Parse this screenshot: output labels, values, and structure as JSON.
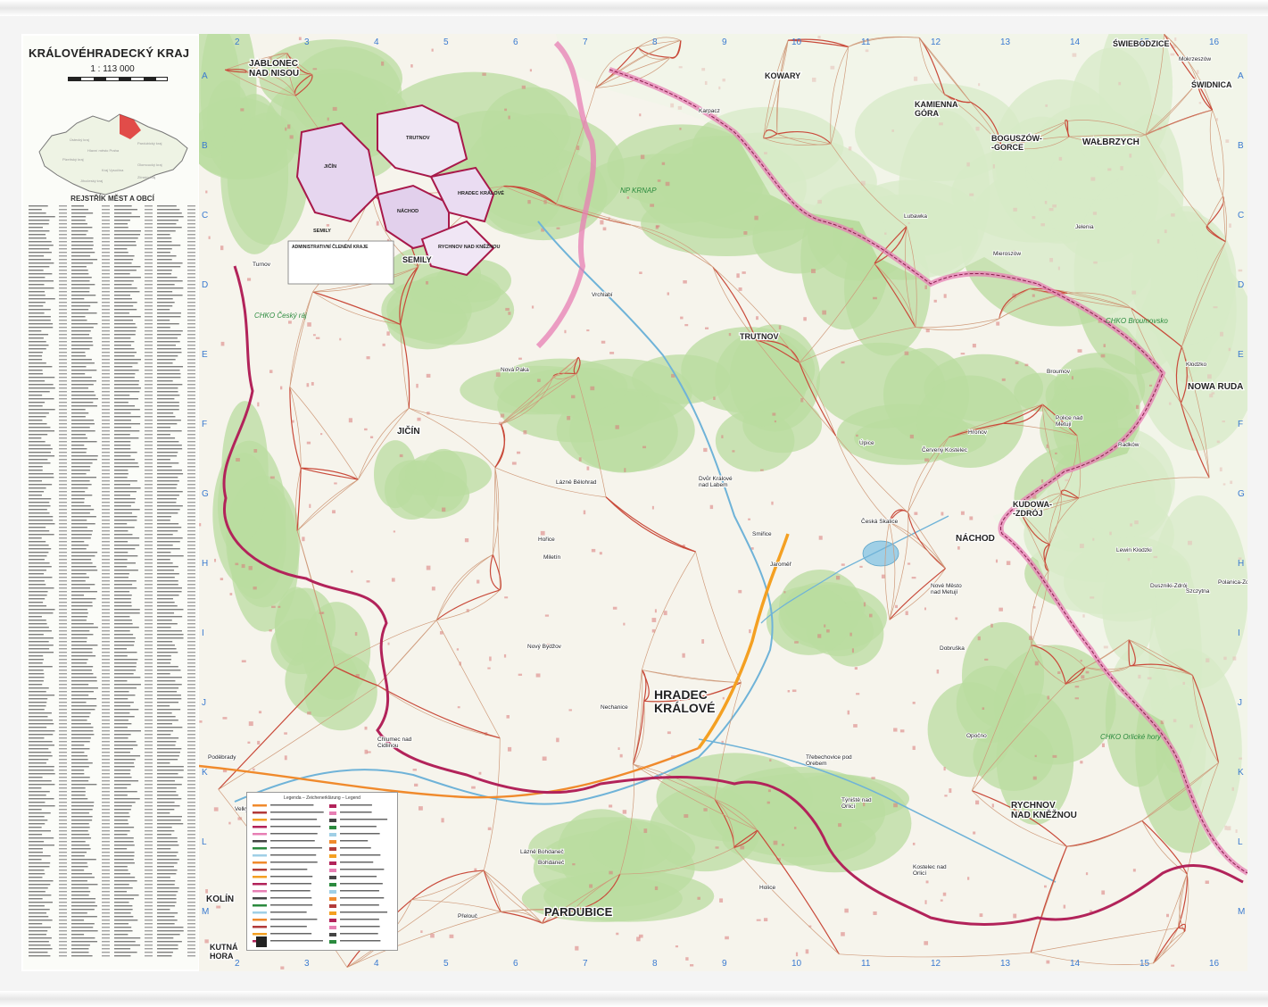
{
  "title": "KRÁLOVÉHRADECKÝ KRAJ",
  "scale": "1 : 113 000",
  "index_title": "REJSTŘÍK MĚST A OBCÍ",
  "admin_title": "ADMINISTRATIVNÍ ČLENĚNÍ KRAJE",
  "legend_title": "Legenda – Zeichenerklärung – Legend",
  "grid_numbers": [
    "2",
    "3",
    "4",
    "5",
    "6",
    "7",
    "8",
    "9",
    "10",
    "11",
    "12",
    "13",
    "14",
    "15",
    "16"
  ],
  "grid_letters": [
    "A",
    "B",
    "C",
    "D",
    "E",
    "F",
    "G",
    "H",
    "I",
    "J",
    "K",
    "L",
    "M"
  ],
  "cities_major": [
    "HRADEC KRÁLOVÉ",
    "PARDUBICE",
    "NÁCHOD",
    "TRUTNOV",
    "JIČÍN",
    "RYCHNOV NAD KNĚŽNOU",
    "KUDOWA-ZDRÓJ",
    "WAŁBRZYCH",
    "NOWA RUDA",
    "JABLONEC NAD NISOU",
    "SEMILY",
    "KOWARY",
    "KAMIENNA GÓRA",
    "BOGUSZÓW-GORCE",
    "ŚWIEBODZICE",
    "ŚWIDNICA",
    "KOLÍN",
    "KUTNÁ HORA"
  ],
  "towns": [
    "Dvůr Králové nad Labem",
    "Jaroměř",
    "Hořice",
    "Nová Paka",
    "Nový Bydžov",
    "Chlumec nad Cidlinou",
    "Česká Skalice",
    "Nové Město nad Metují",
    "Broumov",
    "Vrchlabí",
    "Úpice",
    "Třebechovice pod Orebem",
    "Kostelec nad Orlicí",
    "Dobruška",
    "Týniště nad Orlicí",
    "Holice",
    "Poděbrady",
    "Lázně Bohdaneč",
    "Hronov",
    "Police nad Metují",
    "Lubawka",
    "Mieroszów",
    "Radków",
    "Kłodzko",
    "Duszniki-Zdrój",
    "Lewin Kłodzki",
    "Szczytna",
    "Polanica-Zdrój",
    "Jelenia",
    "Mokrzeszów",
    "Karpacz",
    "Turnov",
    "Lázně Bělohrad",
    "Miletín",
    "Smiřice",
    "Opočno",
    "Nechanice",
    "Velký Osek",
    "Přelouč",
    "Bohdaneč",
    "Červený Kostelec"
  ],
  "protected_areas": [
    "NP KRNAP",
    "CHKO Český ráj",
    "CHKO Broumovsko",
    "CHKO Orlické hory"
  ],
  "inset_regions": [
    "JIČÍN",
    "TRUTNOV",
    "NÁCHOD",
    "HRADEC KRÁLOVÉ",
    "RYCHNOV NAD KNĚŽNOU",
    "SEMILY",
    "JABLONEC NAD NISOU"
  ],
  "colors": {
    "forest": "#b9dca0",
    "open": "#f7f5ee",
    "border_region": "#b2235a",
    "border_state": "#e77fb4",
    "road_main": "#f08a2c",
    "road_minor": "#b23a3a",
    "water": "#9fcfe6",
    "motorway": "#f4a022"
  }
}
